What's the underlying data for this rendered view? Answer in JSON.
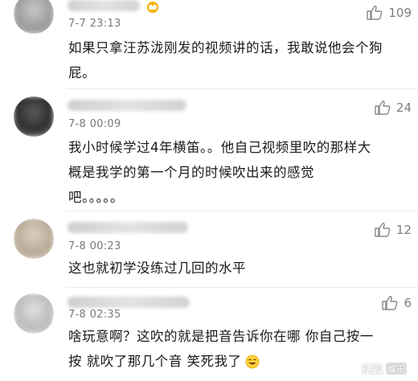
{
  "comments": [
    {
      "time": "7-7 23:13",
      "likes": "109",
      "text_lines": [
        "如果只拿汪苏泷刚发的视频讲的话，我敢说他会个狗",
        "屁。"
      ]
    },
    {
      "time": "7-8 00:09",
      "likes": "24",
      "text_lines": [
        "我小时候学过4年横笛。。他自己视频里吹的那样大",
        "概是我学的第一个月的时候吹出来的感觉",
        "吧。。。。。"
      ]
    },
    {
      "time": "7-8 00:23",
      "likes": "12",
      "text_lines": [
        "这也就初学没练过几回的水平"
      ]
    },
    {
      "time": "7-8 02:35",
      "likes": "6",
      "text_lines": [
        "啥玩意啊？这吹的就是把音告诉你在哪 你自己按一",
        "按 就吹了那几个音 笑死我了"
      ]
    }
  ],
  "watermark": {
    "text": "搜狐",
    "tag": "娱乐"
  },
  "icons": {
    "like": "thumbs-up-icon",
    "badge": "crown-badge-icon",
    "emoji": "laughing-emoji-icon"
  }
}
